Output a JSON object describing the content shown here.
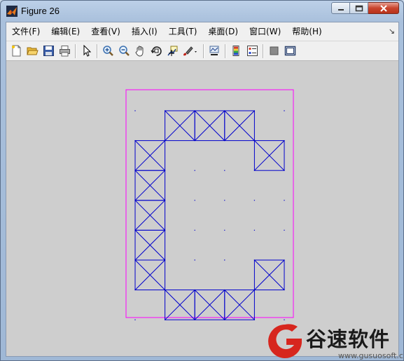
{
  "window": {
    "title": "Figure 26",
    "accent": "#c9442c"
  },
  "menu": {
    "items": [
      "文件(F)",
      "编辑(E)",
      "查看(V)",
      "插入(I)",
      "工具(T)",
      "桌面(D)",
      "窗口(W)",
      "帮助(H)"
    ]
  },
  "toolbar": {
    "icons": [
      "new-figure-icon",
      "open-file-icon",
      "save-icon",
      "print-icon",
      "pointer-icon",
      "zoom-in-icon",
      "zoom-out-icon",
      "pan-hand-icon",
      "rotate-3d-icon",
      "data-cursor-icon",
      "brush-icon",
      "link-plot-icon",
      "colorbar-icon",
      "legend-icon",
      "hide-plot-tools-icon",
      "show-plot-tools-icon"
    ]
  },
  "figure": {
    "box_color": "#ff00ff",
    "mesh_color": "#0000cc",
    "grid": {
      "cols": 5,
      "rows": 7
    },
    "elements": [
      [
        1,
        0
      ],
      [
        2,
        0
      ],
      [
        3,
        0
      ],
      [
        0,
        1
      ],
      [
        4,
        1
      ],
      [
        0,
        2
      ],
      [
        0,
        3
      ],
      [
        0,
        4
      ],
      [
        0,
        5
      ],
      [
        4,
        5
      ],
      [
        1,
        6
      ],
      [
        2,
        6
      ],
      [
        3,
        6
      ]
    ]
  },
  "watermark": {
    "text": "谷速软件",
    "url": "www.gusuosoft.com",
    "color": "#d7261e"
  }
}
